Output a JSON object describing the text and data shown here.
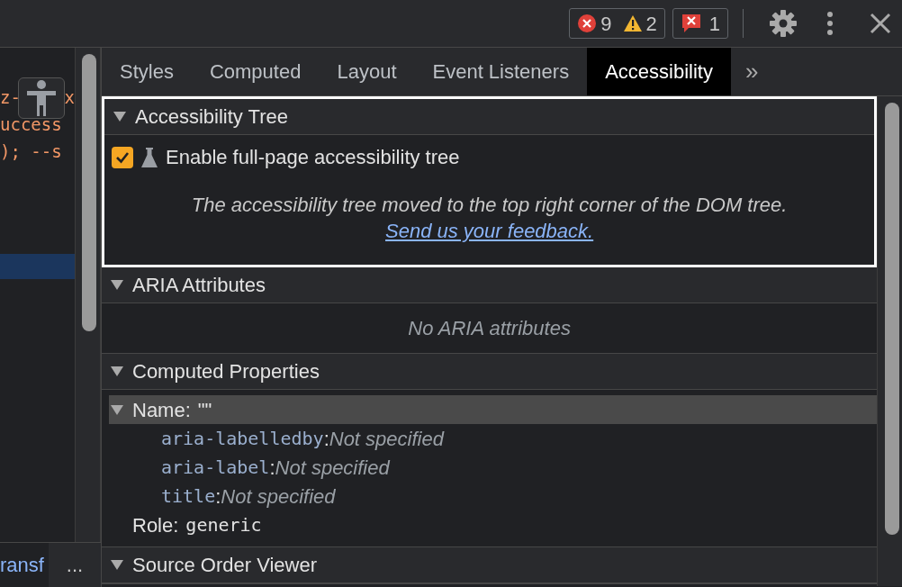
{
  "toolbar": {
    "errors": "9",
    "warnings": "2",
    "issues": "1"
  },
  "code_panel": {
    "lines": [
      {
        "text": "z-",
        "tail": "x"
      },
      {
        "text": "uccess"
      },
      {
        "text": "); --s"
      }
    ],
    "breadcrumb": "ransf",
    "more_button": "..."
  },
  "tabs": [
    {
      "label": "Styles",
      "selected": false
    },
    {
      "label": "Computed",
      "selected": false
    },
    {
      "label": "Layout",
      "selected": false
    },
    {
      "label": "Event Listeners",
      "selected": false
    },
    {
      "label": "Accessibility",
      "selected": true
    }
  ],
  "tabs_overflow": "»",
  "sections": [
    {
      "title": "Accessibility Tree",
      "expanded": true,
      "focused": true,
      "checkbox": {
        "label": "Enable full-page accessibility tree",
        "checked": true
      },
      "note": "The accessibility tree moved to the top right corner of the DOM tree.",
      "link": "Send us your feedback."
    },
    {
      "title": "ARIA Attributes",
      "expanded": true,
      "focused": false,
      "empty_text": "No ARIA attributes"
    },
    {
      "title": "Computed Properties",
      "expanded": true,
      "focused": false,
      "properties": [
        {
          "label": "Name:",
          "value": "\"\"",
          "selected": true,
          "expanded": true,
          "children": [
            {
              "name": "aria-labelledby",
              "separator": ":",
              "value": "Not specified"
            },
            {
              "name": "aria-label",
              "separator": ":",
              "value": "Not specified"
            },
            {
              "name": "title",
              "separator": ":",
              "value": "Not specified"
            }
          ]
        },
        {
          "label": "Role:",
          "value": "generic",
          "selected": false
        }
      ]
    },
    {
      "title": "Source Order Viewer",
      "expanded": true,
      "focused": false
    }
  ]
}
